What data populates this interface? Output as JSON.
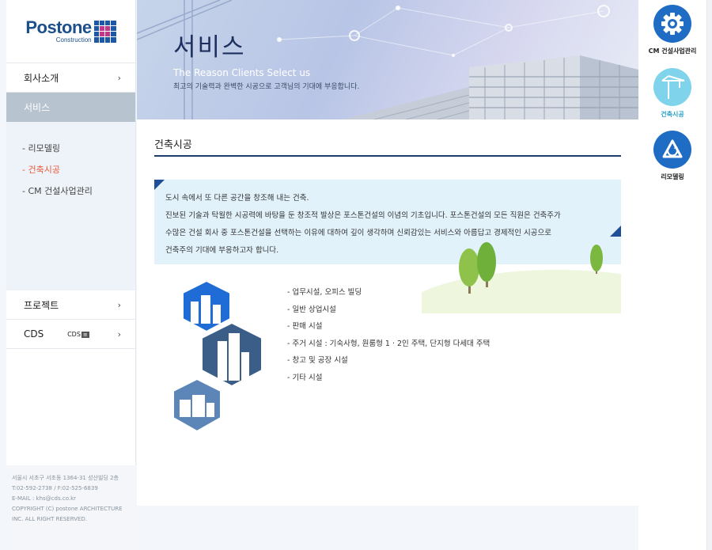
{
  "logo": {
    "wordmark": "Postone",
    "sub": "Construction"
  },
  "sidebar": {
    "items": [
      {
        "label": "회사소개"
      },
      {
        "label": "서비스"
      },
      {
        "label": "프로젝트"
      },
      {
        "label": "CDS"
      }
    ],
    "submenu": [
      "- 리모델링",
      "- 건축시공",
      "- CM 건설사업관리"
    ],
    "cds_badge": "CDS",
    "footer": {
      "address": "서울시 서초구 서초동 1364-31 성산빌딩 2층",
      "phone": "T:02-592-2738 / F:02-525-6839",
      "email": "E-MAIL : khs@cds.co.kr",
      "copyright": "COPYRIGHT (C) postone ARCHITECTURE INC. ALL RIGHT RESERVED."
    }
  },
  "banner": {
    "title": "서비스",
    "subtitle": "The Reason Clients Select us",
    "caption": "최고의 기술력과 완벽한 시공으로 고객님의 기대에 부응합니다."
  },
  "main": {
    "page_title": "건축시공",
    "intro": [
      "도시 속에서 또 다른 공간을 창조해 내는 건축.",
      "진보된 기술과 탁월한 시공력에 바탕을 둔 창조적 발상은 포스톤건설의 이념의 기초입니다. 포스톤건설의 모든 직원은 건축주가",
      "수많은 건설 회사 중 포스톤건설을 선택하는 이유에 대하여 깊이 생각하며 신뢰감있는 서비스와 아름답고 경제적인 시공으로",
      "건축주의 기대에 부응하고자 합니다."
    ],
    "list": [
      "- 업무시설, 오피스 빌딩",
      "- 일반 상업시설",
      "- 판매 시설",
      "- 주거 시설 : 기숙사형, 원룸형  1 · 2인 주택, 단지형 다세대 주택",
      "- 창고 및 공장 시설",
      "- 기타 시설"
    ]
  },
  "quick_links": [
    {
      "label": "CM 건설사업관리",
      "icon": "gear-icon",
      "color": "#1f6cc4"
    },
    {
      "label": "건축시공",
      "icon": "crane-icon",
      "color": "#7fd3ea"
    },
    {
      "label": "리모델링",
      "icon": "recycle-icon",
      "color": "#1f6cc4"
    }
  ],
  "colors": {
    "accent": "#e85a3a",
    "navy": "#1f3d6c",
    "active_nav": "#b7c3cf"
  }
}
